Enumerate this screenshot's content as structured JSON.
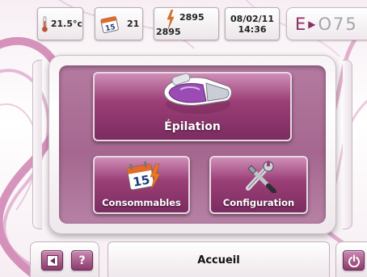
{
  "status_bar": {
    "temperature": "21.5°c",
    "calendar_icon_day": "15",
    "consumables_count": "21",
    "flash_count_top": "2895",
    "flash_count_bottom": "2895",
    "date": "08/02/11",
    "time": "14:36",
    "brand_prefix": "E",
    "brand_suffix": "O75"
  },
  "menu": {
    "epilation_label": "Épilation",
    "consommables_label": "Consommables",
    "consommables_icon_day": "15",
    "configuration_label": "Configuration"
  },
  "bottom_bar": {
    "back_icon": "back-arrow-icon",
    "help_label": "?",
    "title": "Accueil",
    "power_icon": "power-icon"
  },
  "colors": {
    "accent": "#9b3f77",
    "accent_dark": "#7b2c60",
    "panel_bg": "#a5678f",
    "brand_magenta": "#8c2f66",
    "brand_grey": "#a2a6ad"
  }
}
